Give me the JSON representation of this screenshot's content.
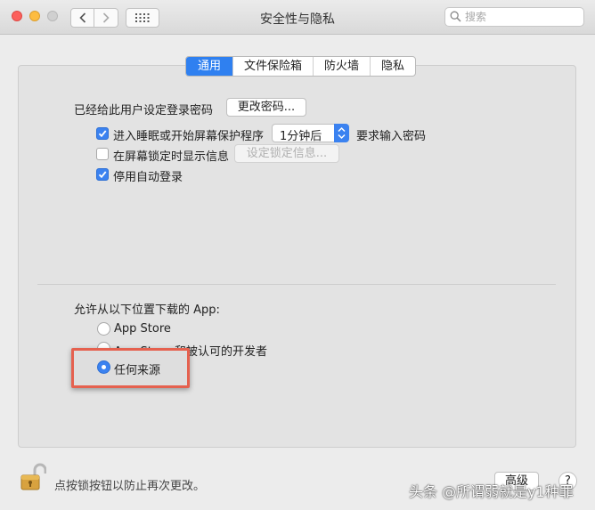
{
  "window": {
    "title": "安全性与隐私"
  },
  "search": {
    "placeholder": "搜索"
  },
  "tabs": [
    {
      "label": "通用",
      "active": true
    },
    {
      "label": "文件保险箱",
      "active": false
    },
    {
      "label": "防火墙",
      "active": false
    },
    {
      "label": "隐私",
      "active": false
    }
  ],
  "general": {
    "password_label": "已经给此用户设定登录密码",
    "change_password_button": "更改密码...",
    "require_password": {
      "label": "进入睡眠或开始屏幕保护程序",
      "checked": true,
      "delay": "1分钟后",
      "suffix": "要求输入密码"
    },
    "lock_message": {
      "label": "在屏幕锁定时显示信息",
      "checked": false,
      "button": "设定锁定信息..."
    },
    "disable_autologin": {
      "label": "停用自动登录",
      "checked": true
    }
  },
  "downloads": {
    "heading": "允许从以下位置下载的 App:",
    "options": [
      {
        "label": "App Store",
        "selected": false
      },
      {
        "label": "App Store 和被认可的开发者",
        "selected": false
      },
      {
        "label": "任何来源",
        "selected": true
      }
    ]
  },
  "footer": {
    "lock_text": "点按锁按钮以防止再次更改。",
    "advanced_button": "高级",
    "help_button": "?"
  },
  "watermark": "头条 @所谓弱就是y1种罪",
  "colors": {
    "accent": "#3b82f0",
    "highlight_border": "#e5614f"
  }
}
